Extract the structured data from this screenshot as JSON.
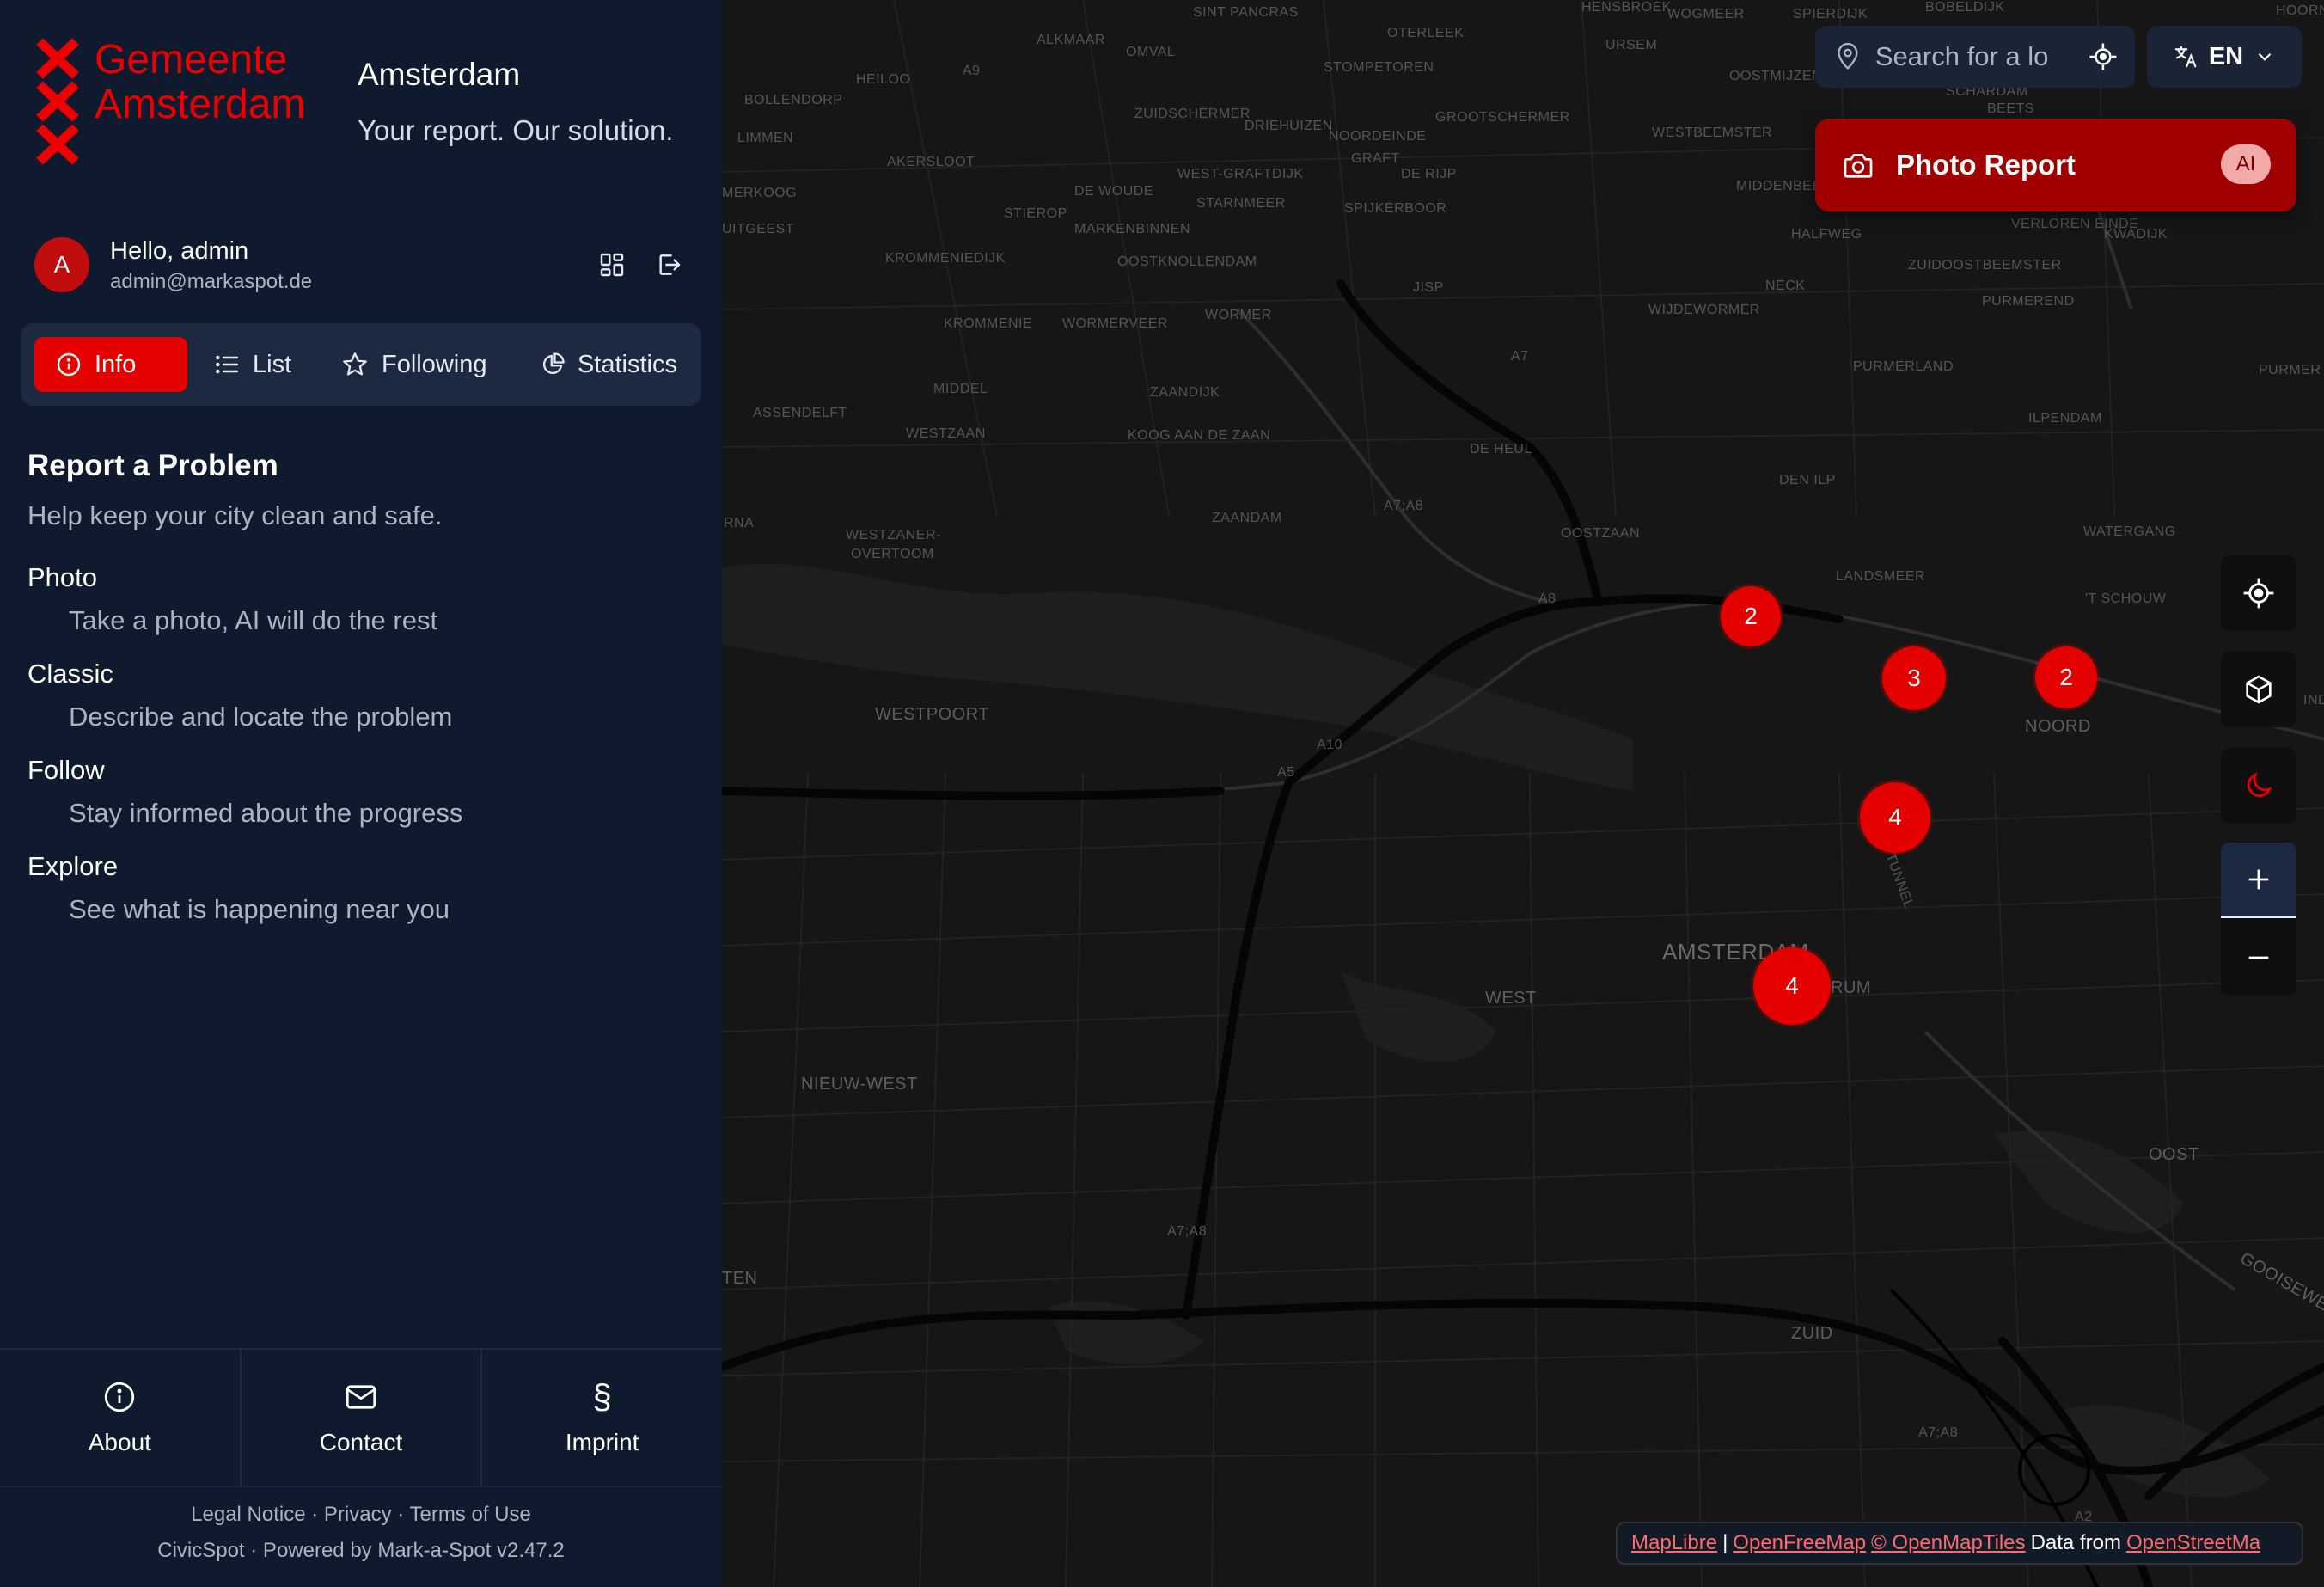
{
  "brand": {
    "line1": "Gemeente",
    "line2": "Amsterdam",
    "accent": "#ec0000"
  },
  "header": {
    "city": "Amsterdam",
    "tagline": "Your report. Our solution."
  },
  "user": {
    "initial": "A",
    "greeting": "Hello, admin",
    "email": "admin@markaspot.de"
  },
  "tabs": [
    {
      "label": "Info",
      "icon": "info-icon",
      "active": true
    },
    {
      "label": "List",
      "icon": "list-icon"
    },
    {
      "label": "Following",
      "icon": "star-icon"
    },
    {
      "label": "Statistics",
      "icon": "pie-chart-icon"
    }
  ],
  "report": {
    "title": "Report a Problem",
    "subtitle": "Help keep your city clean and safe.",
    "features": [
      {
        "title": "Photo",
        "desc": "Take a photo, AI will do the rest"
      },
      {
        "title": "Classic",
        "desc": "Describe and locate the problem"
      },
      {
        "title": "Follow",
        "desc": "Stay informed about the progress"
      },
      {
        "title": "Explore",
        "desc": "See what is happening near you"
      }
    ]
  },
  "bottom_nav": [
    {
      "label": "About",
      "icon": "info-icon"
    },
    {
      "label": "Contact",
      "icon": "mail-icon"
    },
    {
      "label": "Imprint",
      "icon": "section-icon",
      "glyph": "§"
    }
  ],
  "footer": {
    "links": "Legal Notice · Privacy · Terms of Use",
    "powered": "CivicSpot · Powered by Mark-a-Spot v2.47.2"
  },
  "map": {
    "search_placeholder": "Search for a lo",
    "language": "EN",
    "photo_report": {
      "label": "Photo Report",
      "badge": "AI"
    },
    "clusters": [
      {
        "count": "2"
      },
      {
        "count": "3"
      },
      {
        "count": "2"
      },
      {
        "count": "4"
      },
      {
        "count": "4"
      }
    ],
    "attribution": {
      "maplibre": "MapLibre",
      "sep": "|",
      "openfreemap": "OpenFreeMap",
      "openmaptiles": "© OpenMapTiles",
      "data_from": "Data from",
      "osm": "OpenStreetMa"
    },
    "labels": [
      "SINT PANCRAS",
      "OTERLEEK",
      "HENSBROEK",
      "WOGMEER",
      "SPIERDIJK",
      "BOBELDIJK",
      "HOORN",
      "ALKMAAR",
      "OMVAL",
      "URSEM",
      "STOMPETOREN",
      "OOSTMIJZEN",
      "SCHARDAM",
      "BEETS",
      "HEILOO",
      "BOLLENDORP",
      "A9",
      "LIMMEN",
      "ZUIDSCHERMER",
      "DRIEHUIZEN",
      "NOORDEINDE",
      "GROOTSCHERMER",
      "WESTBEEMSTER",
      "AKERSLOOT",
      "GRAFT",
      "WEST-GRAFTDIJK",
      "DE RIJP",
      "DE WOUDE",
      "STARNMEER",
      "STIEROP",
      "MARKENBINNEN",
      "SPIJKERBOOR",
      "MIDDENBEEMSTER",
      "HALFWEG",
      "VERLOREN EINDE",
      "KWADIJK",
      "MERKOOG",
      "UITGEEST",
      "KROMMENIEDIJK",
      "OOSTKNOLLENDAM",
      "ZUIDOOSTBEEMSTER",
      "NECK",
      "PURMEREND",
      "JISP",
      "WIJDEWORMER",
      "WORMER",
      "KROMMENIE",
      "WORMERVEER",
      "A7",
      "PURMERLAND",
      "PURMER",
      "MIDDEL",
      "ZAANDIJK",
      "WESTZAAN",
      "ASSENDELFT",
      "KOOG AAN DE ZAAN",
      "ILPENDAM",
      "DE HEUL",
      "DEN ILP",
      "A7;A8",
      "ZAANDAM",
      "OOSTZAAN",
      "WATERGANG",
      "WESTZANER-",
      "OVERTOOM",
      "RNA",
      "LANDSMEER",
      "'T SCHOUW",
      "A8",
      "WESTPOORT",
      "NOORD",
      "A10",
      "A5",
      "TUNNEL",
      "AMSTERDAM",
      "RUM",
      "WEST",
      "NIEUW-WEST",
      "OOST",
      "TEN",
      "GOOISEWE",
      "ZUID",
      "A2",
      "IND"
    ]
  }
}
